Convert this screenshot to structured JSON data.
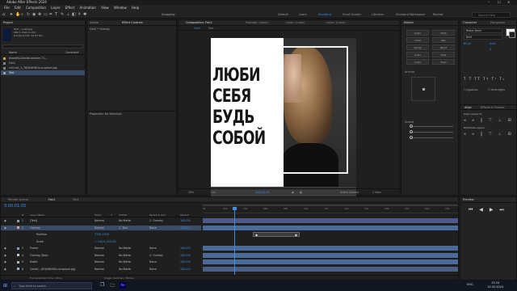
{
  "app": {
    "title": "Adobe After Effects 2024",
    "win_controls": [
      "–",
      "☐",
      "✕"
    ]
  },
  "menu": [
    "File",
    "Edit",
    "Composition",
    "Layer",
    "Effect",
    "Animation",
    "View",
    "Window",
    "Help"
  ],
  "toolbar": {
    "snapping_label": "Snapping",
    "workspaces": [
      "Default",
      "Learn",
      "Standard",
      "Small Screen",
      "Libraries",
      "Standard Workspace",
      "Review"
    ],
    "active_workspace": "Standard",
    "search_placeholder": "Search Help"
  },
  "project_panel": {
    "tab": "Project",
    "effects_tab": "Effect Controls",
    "preview_name": "Text _ usiell.jpg",
    "preview_info": [
      "960 x 1500 (1.00)",
      "Δ 0;00;10;00, 29.97 fps"
    ],
    "search_placeholder": "",
    "col_name": "Name",
    "col_comment": "Comment",
    "items": [
      {
        "name": "beautiful-blonde-woman-71...",
        "color": "#c9a14a"
      },
      {
        "name": "Fon2",
        "color": "#7f7f7f"
      },
      {
        "name": "cell.mt1_1_78QkWhNOs-unsplash.jpg",
        "color": "#7f7f7f"
      },
      {
        "name": "Text",
        "color": "#9c9c9c",
        "selected": true
      }
    ]
  },
  "effect_panel": {
    "tabs": [
      "Effect Controls",
      "Adobe"
    ],
    "title": "Fon2 • Overlay",
    "properties_label": "Properties: No Selection"
  },
  "composition": {
    "tab_comp": "Composition: Fon2",
    "tab_footage": "Footage: (none)",
    "tab_layer": "Layer: (none)",
    "subtabs": [
      "Fon2",
      "Text"
    ],
    "poster_text": [
      "ЛЮБИ",
      "СЕБЯ",
      "БУДЬ",
      "СОБОЙ"
    ],
    "zoom": "50%",
    "resolution": "Full",
    "timecode": "0;00;01;05",
    "camera": "Active Camera",
    "views": "1 View"
  },
  "motion_panel": {
    "title": "Motion",
    "buttons": [
      "Scale",
      "Slide",
      "Orbit",
      "Spin",
      "Swing",
      "Bend",
      "Scale",
      "Fade",
      "Scale",
      "Track"
    ],
    "anchor_label": "Anchor",
    "speed_label": "Speed"
  },
  "character_panel": {
    "tabs": [
      "Character",
      "Paragraph"
    ],
    "font": "Bebas Neue",
    "style": "Bold",
    "size": "80 px",
    "leading": "Auto",
    "tracking": "0",
    "align_tabs": [
      "Align",
      "Effects & Presets"
    ],
    "align_to": "Align Layers to:",
    "distribute": "Distribute Layers:",
    "ligatures": "Ligatures",
    "hindi": "Hindi Digits"
  },
  "timeline": {
    "tabs": [
      "Render Queue",
      "Fon2",
      "Text"
    ],
    "active_tab": "Fon2",
    "timecode": "0:00:01:05",
    "headers": [
      "#",
      "Layer Name",
      "Mode",
      "T",
      "TrkMat",
      "Parent & Link",
      "Stretch"
    ],
    "layers": [
      {
        "num": "1",
        "name": "[Text]",
        "mode": "Normal",
        "trkmat": "No Matte",
        "parent": "2. Overlay",
        "stretch": "100.0%",
        "color": "#9c9c9c",
        "track": "#4f5a8c"
      },
      {
        "num": "2",
        "name": "Overlay",
        "mode": "Normal",
        "trkmat": "1. Text",
        "parent": "None",
        "stretch": "100.0%",
        "color": "#d9a0a0",
        "track": "#4b6b9a",
        "selected": true
      },
      {
        "num": "",
        "name": "Position",
        "mode": "3752,1940",
        "trkmat": "",
        "parent": "",
        "stretch": "",
        "color": "",
        "track": ""
      },
      {
        "num": "",
        "name": "Scale",
        "mode": "∞ 100.0,100.0%",
        "trkmat": "",
        "parent": "",
        "stretch": "",
        "color": "",
        "track": ""
      },
      {
        "num": "3",
        "name": "Frame",
        "mode": "Normal",
        "trkmat": "No Matte",
        "parent": "None",
        "stretch": "100.0%",
        "color": "#8ba0c9",
        "track": "#4b6b9a"
      },
      {
        "num": "4",
        "name": "Overlay_Back",
        "mode": "Normal",
        "trkmat": "No Matte",
        "parent": "2. Overlay",
        "stretch": "100.0%",
        "color": "#c3c3c3",
        "track": "#4b6b9a"
      },
      {
        "num": "5",
        "name": "Matte",
        "mode": "Normal",
        "trkmat": "No Matte",
        "parent": "None",
        "stretch": "100.0%",
        "color": "#b5b5b5",
        "track": "#4b6b9a"
      },
      {
        "num": "6",
        "name": "Cellat(...)RQkWhNOs-unsplash.jpg",
        "mode": "Normal",
        "trkmat": "No Matte",
        "parent": "None",
        "stretch": "100.0%",
        "color": "#9fb0c8",
        "track": "#4a5e86"
      }
    ],
    "ruler": [
      "0s",
      "02s",
      "04s",
      "06s",
      "08s",
      "10s",
      "12s",
      "14s",
      "16s",
      "18s",
      "20s",
      "22s",
      "24s"
    ],
    "footer_left": "Frame Render Time: 20ms",
    "footer_mid": "Toggle Switches / Modes"
  },
  "preview_panel": {
    "title": "Preview"
  },
  "taskbar": {
    "search_placeholder": "Type here to search",
    "time": "13:34",
    "date": "13.03.2024",
    "lang": "ENG"
  },
  "colors": {
    "accent": "#3c8ee6",
    "panel": "#232323",
    "timeline_track": "#4b6b9a",
    "playhead": "#3c8ee6"
  }
}
